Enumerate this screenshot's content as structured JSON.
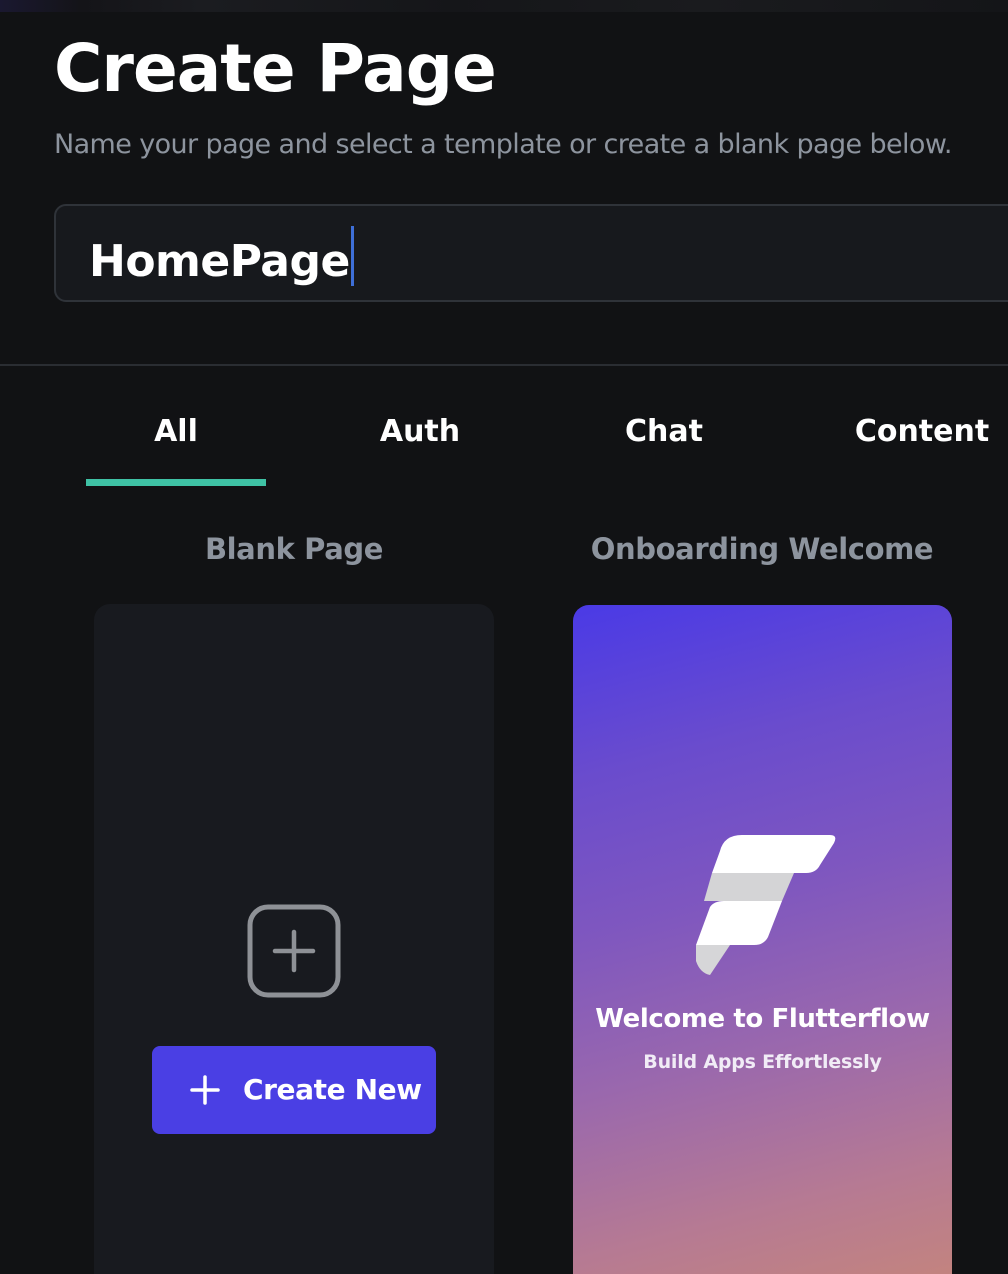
{
  "header": {
    "title": "Create Page",
    "subtitle": "Name your page and select a template or create a blank page below."
  },
  "name_input": {
    "value": "HomePage"
  },
  "tabs": [
    {
      "label": "All",
      "selected": true
    },
    {
      "label": "Auth",
      "selected": false
    },
    {
      "label": "Chat",
      "selected": false
    },
    {
      "label": "Content",
      "selected": false
    }
  ],
  "templates": {
    "blank": {
      "label": "Blank Page",
      "icon": "add-square-icon",
      "button_label": "Create New",
      "button_icon": "plus-icon"
    },
    "onboarding": {
      "label": "Onboarding Welcome",
      "preview_title": "Welcome to Flutterflow",
      "preview_subtitle": "Build Apps Effortlessly",
      "icon": "flutterflow-logo-icon"
    }
  },
  "colors": {
    "background": "#111214",
    "accent_tab": "#3fc2a5",
    "primary_button": "#4a3fe4",
    "caret": "#3e6fd8",
    "muted_text": "#8d949e"
  }
}
